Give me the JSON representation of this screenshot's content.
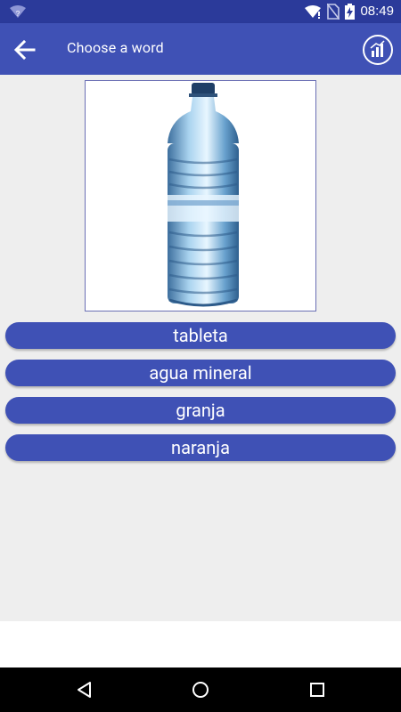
{
  "status": {
    "time": "08:49",
    "wifi_icon": "wifi-question-icon",
    "battery_icon": "battery-charging-icon"
  },
  "app_bar": {
    "title": "Choose a word",
    "back_icon": "arrow-back-icon",
    "stats_icon": "bar-chart-icon"
  },
  "question": {
    "image": "water-bottle-image"
  },
  "answers": [
    {
      "label": "tableta"
    },
    {
      "label": "agua mineral"
    },
    {
      "label": "granja"
    },
    {
      "label": "naranja"
    }
  ],
  "colors": {
    "primary": "#3f51b5",
    "primary_dark": "#2b3a9a",
    "background": "#eeeeee"
  },
  "nav": {
    "back": "nav-back-icon",
    "home": "nav-home-icon",
    "recents": "nav-recents-icon"
  }
}
